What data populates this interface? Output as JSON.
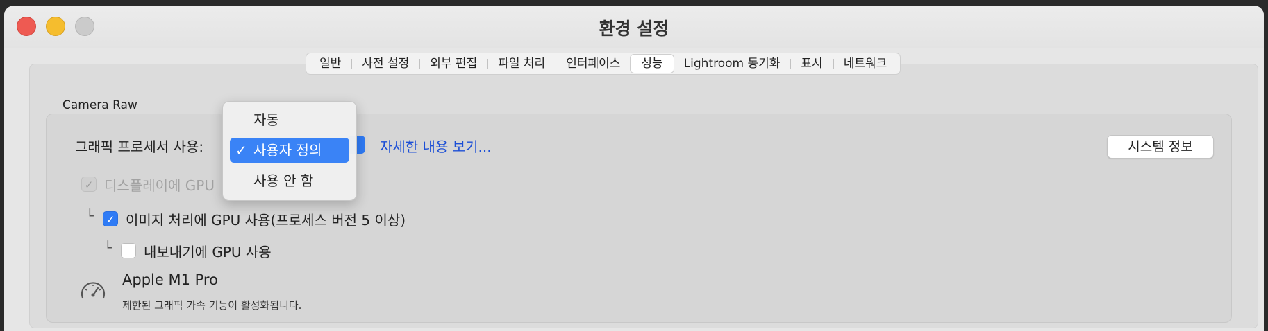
{
  "window": {
    "title": "환경 설정"
  },
  "tabs": [
    {
      "label": "일반"
    },
    {
      "label": "사전 설정"
    },
    {
      "label": "외부 편집"
    },
    {
      "label": "파일 처리"
    },
    {
      "label": "인터페이스"
    },
    {
      "label": "성능",
      "active": true
    },
    {
      "label": "Lightroom 동기화"
    },
    {
      "label": "표시"
    },
    {
      "label": "네트워크"
    }
  ],
  "camera_raw": {
    "section_label": "Camera Raw",
    "gpu_label": "그래픽 프로세서 사용:",
    "details_link": "자세한 내용 보기...",
    "system_info_button": "시스템 정보",
    "display_gpu_text": "디스플레이에 GPU",
    "image_processing_text": "이미지 처리에 GPU 사용(프로세스 버전 5 이상)",
    "export_text": "내보내기에 GPU 사용",
    "tree_glyph": "└",
    "gpu_name": "Apple M1 Pro",
    "gpu_status": "제한된 그래픽 가속 기능이 활성화됩니다."
  },
  "dropdown": {
    "options": [
      "자동",
      "사용자 정의",
      "사용 안 함"
    ],
    "selected": "사용자 정의",
    "checkmark": "✓"
  },
  "colors": {
    "accent": "#2f7bf5",
    "link": "#1c4fd6",
    "close": "#ee5a52",
    "minimize": "#f5bd2e"
  }
}
